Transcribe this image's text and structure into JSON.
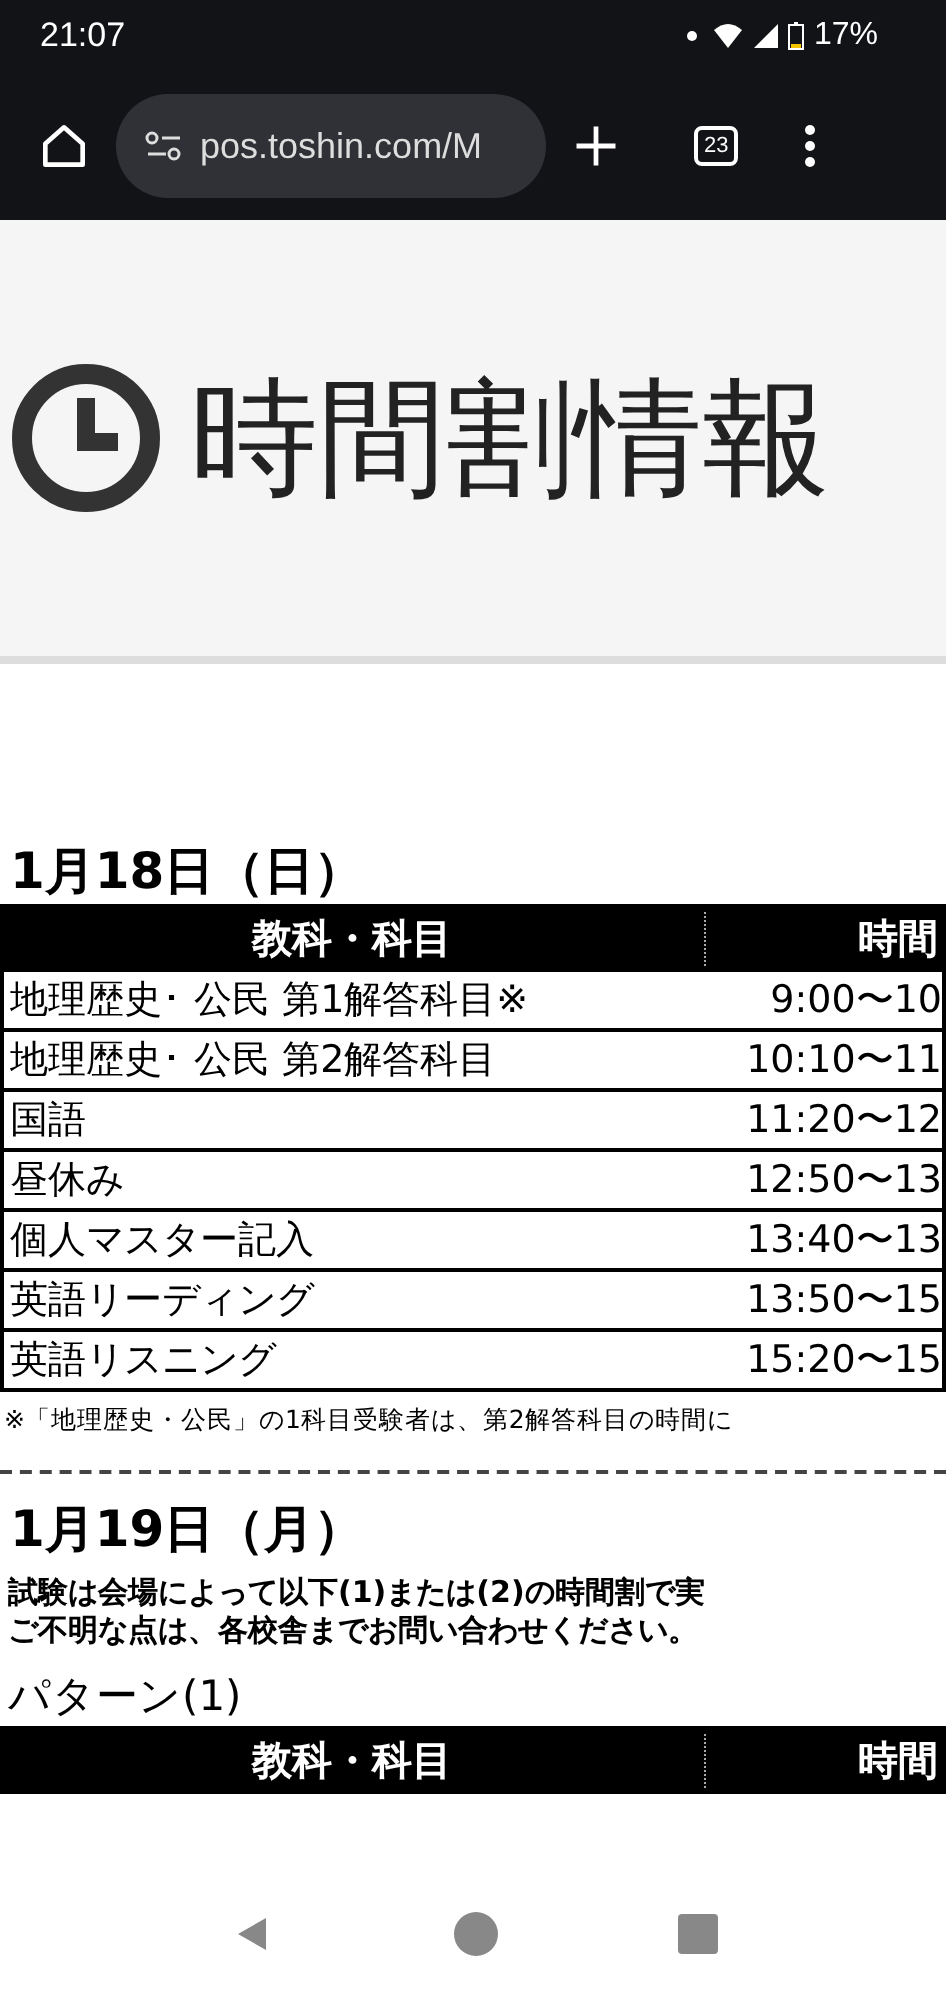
{
  "status_bar": {
    "time": "21:07",
    "battery": "17%"
  },
  "browser": {
    "url": "pos.toshin.com/M",
    "tab_count": "23"
  },
  "page_title": "時間割情報",
  "day1": {
    "date": "1月18日（日）",
    "columns": [
      "教科・科目",
      "時間"
    ],
    "rows": [
      {
        "subject": "地理歴史･ 公民 第1解答科目※",
        "time": "9:00〜10"
      },
      {
        "subject": "地理歴史･ 公民 第2解答科目",
        "time": "10:10〜11"
      },
      {
        "subject": "国語",
        "time": "11:20〜12"
      },
      {
        "subject": "昼休み",
        "time": "12:50〜13"
      },
      {
        "subject": "個人マスター記入",
        "time": "13:40〜13"
      },
      {
        "subject": "英語リーディング",
        "time": "13:50〜15"
      },
      {
        "subject": "英語リスニング",
        "time": "15:20〜15"
      }
    ],
    "footnote": "※「地理歴史・公民」の1科目受験者は、第2解答科目の時間に"
  },
  "day2": {
    "date": "1月19日（月）",
    "notes": [
      "試験は会場によって以下(1)または(2)の時間割で実",
      "ご不明な点は、各校舎までお問い合わせください。"
    ],
    "pattern": "パターン(1)",
    "columns": [
      "教科・科目",
      "時間"
    ]
  }
}
